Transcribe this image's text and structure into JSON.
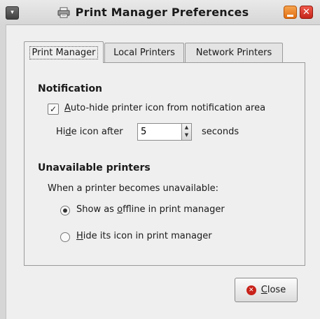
{
  "window": {
    "title": "Print Manager Preferences",
    "menu_glyph": "▾",
    "close_glyph": "✕"
  },
  "tabs": [
    {
      "label": "Print Manager",
      "active": true
    },
    {
      "label": "Local Printers",
      "active": false
    },
    {
      "label": "Network Printers",
      "active": false
    }
  ],
  "notification": {
    "title": "Notification",
    "autohide_checked": true,
    "autohide_check_glyph": "✓",
    "autohide_label_u": "A",
    "autohide_label_rest": "uto-hide printer icon from notification area",
    "hide_after_pre": "Hi",
    "hide_after_u": "d",
    "hide_after_post": "e icon after",
    "hide_after_value": "5",
    "seconds_label": "seconds"
  },
  "unavailable": {
    "title": "Unavailable printers",
    "description": "When a printer becomes unavailable:",
    "option1_pre": "Show as ",
    "option1_u": "o",
    "option1_post": "ffline in print manager",
    "option1_checked": true,
    "option2_u": "H",
    "option2_post": "ide its icon in print manager",
    "option2_checked": false
  },
  "close_button": {
    "label_u": "C",
    "label_rest": "lose",
    "icon_glyph": "✕"
  },
  "colors": {
    "close_red": "#c8221a",
    "minimize_orange": "#e06d12"
  }
}
